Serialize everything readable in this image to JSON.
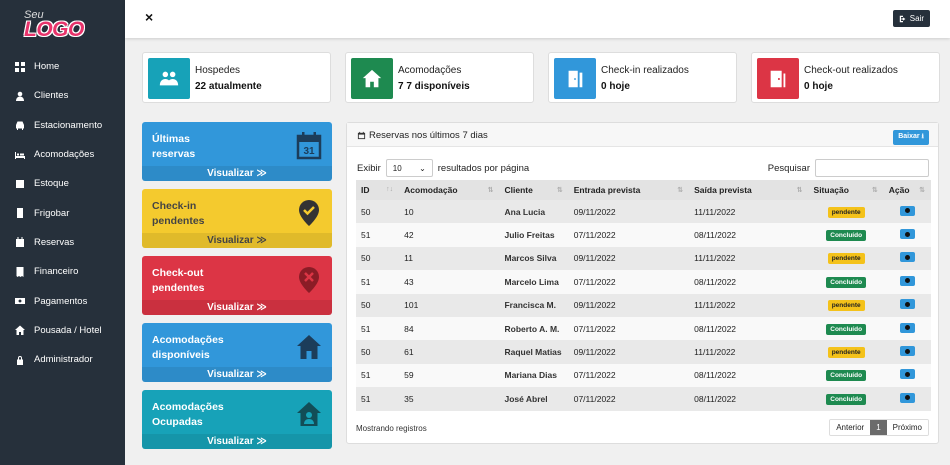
{
  "logo": {
    "small": "Seu",
    "main": "LOGO",
    "color": "#e8336b"
  },
  "sidebar": {
    "items": [
      {
        "label": "Home",
        "icon": "grid-icon"
      },
      {
        "label": "Clientes",
        "icon": "user-icon"
      },
      {
        "label": "Estacionamento",
        "icon": "car-icon"
      },
      {
        "label": "Acomodações",
        "icon": "bed-icon"
      },
      {
        "label": "Estoque",
        "icon": "box-icon"
      },
      {
        "label": "Frigobar",
        "icon": "fridge-icon"
      },
      {
        "label": "Reservas",
        "icon": "calendar-icon"
      },
      {
        "label": "Financeiro",
        "icon": "receipt-icon"
      },
      {
        "label": "Pagamentos",
        "icon": "money-icon"
      },
      {
        "label": "Pousada / Hotel",
        "icon": "home-icon"
      },
      {
        "label": "Administrador",
        "icon": "lock-icon"
      }
    ]
  },
  "topbar": {
    "close_label": "×",
    "logout_label": "Sair"
  },
  "stats": [
    {
      "title": "Hospedes",
      "value": "22 atualmente",
      "color": "#17a2b8",
      "icon": "users-icon"
    },
    {
      "title": "Acomodações",
      "value": "7 7 disponíveis",
      "color": "#1e8a50",
      "icon": "house-icon"
    },
    {
      "title": "Check-in realizados",
      "value": "0 hoje",
      "color": "#3197da",
      "icon": "door-in-icon"
    },
    {
      "title": "Check-out realizados",
      "value": "0 hoje",
      "color": "#dc3545",
      "icon": "door-out-icon"
    }
  ],
  "cards": [
    {
      "title_l1": "Últimas",
      "title_l2": "reservas",
      "link": "Visualizar ≫",
      "color": "#3197da",
      "text_color": "#ffffff",
      "icon": "calendar-31-icon",
      "icon_text": "31"
    },
    {
      "title_l1": "Check-in",
      "title_l2": "pendentes",
      "link": "Visualizar ≫",
      "color": "#f4ca2e",
      "text_color": "#444444",
      "icon": "map-pin-check-icon"
    },
    {
      "title_l1": "Check-out",
      "title_l2": "pendentes",
      "link": "Visualizar ≫",
      "color": "#dc3545",
      "text_color": "#ffffff",
      "icon": "map-pin-x-icon"
    },
    {
      "title_l1": "Acomodações",
      "title_l2": "disponíveis",
      "link": "Visualizar ≫",
      "color": "#3197da",
      "text_color": "#ffffff",
      "icon": "house-icon"
    },
    {
      "title_l1": "Acomodações",
      "title_l2": "Ocupadas",
      "link": "Visualizar ≫",
      "color": "#17a2b8",
      "text_color": "#ffffff",
      "icon": "house-user-icon"
    }
  ],
  "panel": {
    "title": "Reservas nos últimos 7 dias",
    "download_label": "Baixar",
    "show_label": "Exibir",
    "page_size": "10",
    "per_page_label": "resultados por página",
    "search_label": "Pesquisar",
    "search_value": "",
    "columns": [
      "ID",
      "Acomodação",
      "Cliente",
      "Entrada prevista",
      "Saída prevista",
      "Situação",
      "Ação"
    ],
    "rows": [
      {
        "id": "50",
        "acomodacao": "10",
        "cliente": "Ana Lucia",
        "entrada": "09/11/2022",
        "saida": "11/11/2022",
        "situacao": "pendente"
      },
      {
        "id": "51",
        "acomodacao": "42",
        "cliente": "Julio Freitas",
        "entrada": "07/11/2022",
        "saida": "08/11/2022",
        "situacao": "Concluído"
      },
      {
        "id": "50",
        "acomodacao": "11",
        "cliente": "Marcos Silva",
        "entrada": "09/11/2022",
        "saida": "11/11/2022",
        "situacao": "pendente"
      },
      {
        "id": "51",
        "acomodacao": "43",
        "cliente": "Marcelo Lima",
        "entrada": "07/11/2022",
        "saida": "08/11/2022",
        "situacao": "Concluído"
      },
      {
        "id": "50",
        "acomodacao": "101",
        "cliente": "Francisca M.",
        "entrada": "09/11/2022",
        "saida": "11/11/2022",
        "situacao": "pendente"
      },
      {
        "id": "51",
        "acomodacao": "84",
        "cliente": "Roberto A. M.",
        "entrada": "07/11/2022",
        "saida": "08/11/2022",
        "situacao": "Concluído"
      },
      {
        "id": "50",
        "acomodacao": "61",
        "cliente": "Raquel Matias",
        "entrada": "09/11/2022",
        "saida": "11/11/2022",
        "situacao": "pendente"
      },
      {
        "id": "51",
        "acomodacao": "59",
        "cliente": "Mariana Dias",
        "entrada": "07/11/2022",
        "saida": "08/11/2022",
        "situacao": "Concluído"
      },
      {
        "id": "51",
        "acomodacao": "35",
        "cliente": "José Abrel",
        "entrada": "07/11/2022",
        "saida": "08/11/2022",
        "situacao": "Concluído"
      }
    ],
    "footer": "Mostrando  registros",
    "pagination": {
      "prev": "Anterior",
      "current": "1",
      "next": "Próximo"
    }
  }
}
